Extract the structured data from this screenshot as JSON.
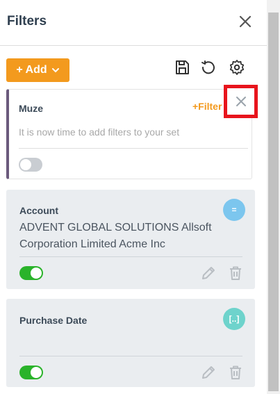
{
  "header": {
    "title": "Filters"
  },
  "toolbar": {
    "add_label": "+ Add",
    "icons": [
      "save-icon",
      "reset-icon",
      "settings-icon"
    ]
  },
  "muze_card": {
    "title": "Muze",
    "filter_link": "+Filter",
    "description": "It is now time to add filters to your set",
    "toggle_on": false
  },
  "cards": [
    {
      "title": "Account",
      "value": "ADVENT GLOBAL SOLUTIONS Allsoft Corporation Limited Acme Inc",
      "badge": "=",
      "toggle_on": true
    },
    {
      "title": "Purchase Date",
      "value": "",
      "badge": "[..]",
      "toggle_on": true
    }
  ],
  "colors": {
    "accent": "#f39a1e",
    "toggle_on": "#2ab32a",
    "highlight": "#e8141c"
  }
}
